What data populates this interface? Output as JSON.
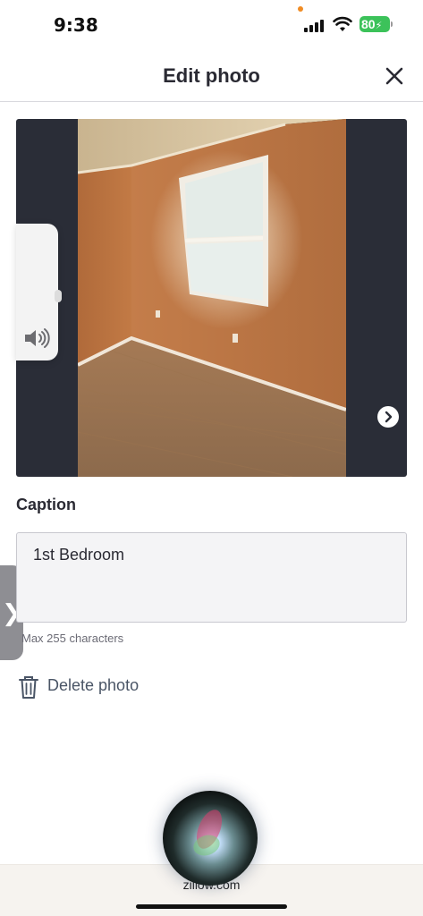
{
  "status_bar": {
    "time": "9:38",
    "battery": "80",
    "battery_color": "#3cc25a"
  },
  "header": {
    "title": "Edit photo",
    "close_icon": "close-icon"
  },
  "photo": {
    "next_icon": "chevron-right-icon"
  },
  "overlays": {
    "volume_icon": "speaker-volume-icon",
    "side_tab_glyph": "❯"
  },
  "caption": {
    "label": "Caption",
    "value": "1st Bedroom",
    "helper": "Max 255 characters"
  },
  "actions": {
    "delete_label": "Delete photo",
    "delete_icon": "trash-icon"
  },
  "browser": {
    "url": "zillow.com"
  }
}
